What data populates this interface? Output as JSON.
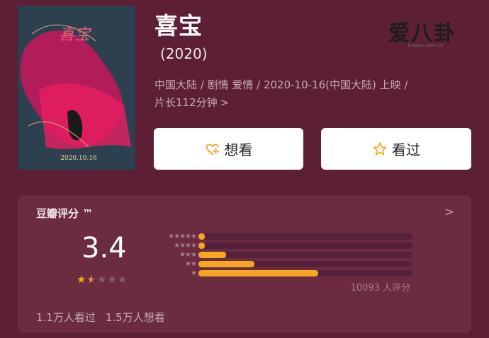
{
  "movie": {
    "title": "喜宝",
    "year": "(2020)",
    "info_line1": "中国大陆 / 剧情 爱情 / 2020-10-16(中国大陆) 上映 /",
    "info_line2": "片长112分钟",
    "info_chevron": ">"
  },
  "poster": {
    "title_art": "喜宝",
    "date": "2020.10.16"
  },
  "buttons": {
    "want_label": "想看",
    "want_icon": "heart-plus-icon",
    "seen_label": "看过",
    "seen_icon": "star-outline-icon"
  },
  "watermark": {
    "logo_text": "爱八卦",
    "sub_text": "bagua.com.cn"
  },
  "rating": {
    "title": "豆瓣评分 ™",
    "chevron": ">",
    "score": "3.4",
    "stars": {
      "filled": 1.5,
      "total": 5
    },
    "distribution": [
      {
        "stars": "★★★★★",
        "fraction": 0.03
      },
      {
        "stars": "★★★★",
        "fraction": 0.03
      },
      {
        "stars": "★★★",
        "fraction": 0.13
      },
      {
        "stars": "★★",
        "fraction": 0.26
      },
      {
        "stars": "★",
        "fraction": 0.56
      }
    ],
    "count_text": "10093 人评分",
    "seen_text": "1.1万人看过",
    "want_text": "1.5万人想看"
  },
  "colors": {
    "background": "#5c1f35",
    "panel": "#6b2b41",
    "accent": "#f5a623",
    "star": "#f5b400"
  }
}
